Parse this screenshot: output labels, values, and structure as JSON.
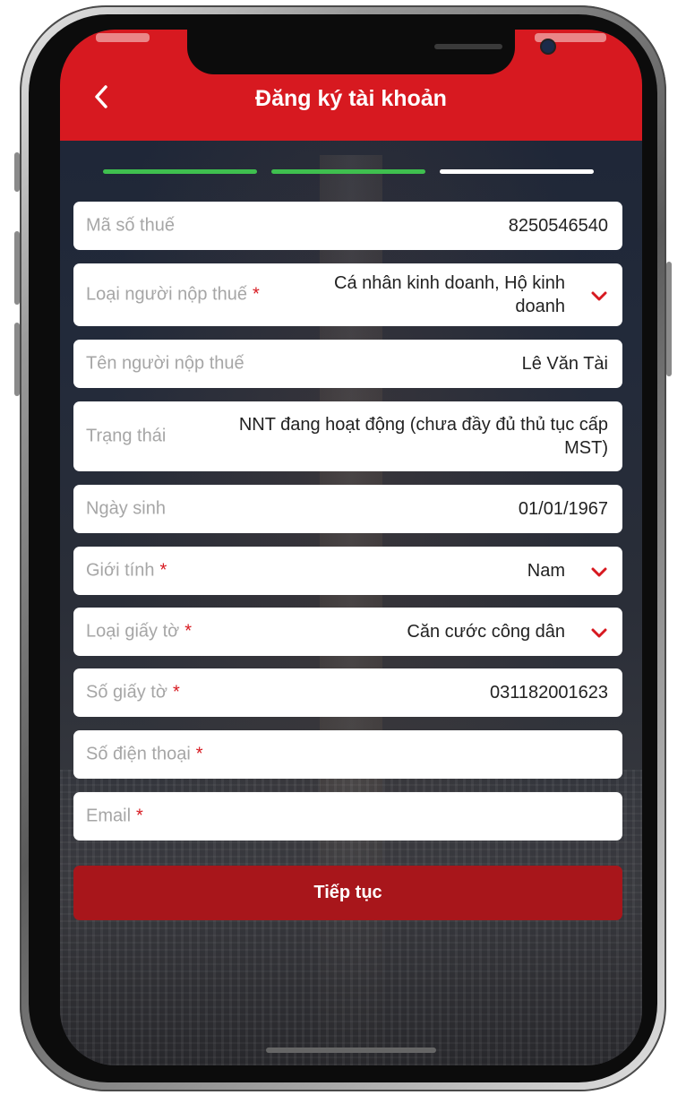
{
  "header": {
    "title": "Đăng ký tài khoản",
    "back_icon": "chevron-left-icon",
    "background_color": "#d71920"
  },
  "progress_steps": [
    {
      "state": "completed",
      "color": "#3fbf4f"
    },
    {
      "state": "completed",
      "color": "#3fbf4f"
    },
    {
      "state": "current",
      "color": "#ffffff"
    }
  ],
  "form": {
    "fields": [
      {
        "label": "Mã số thuế",
        "value": "8250546540",
        "required": false,
        "dropdown": false
      },
      {
        "label": "Loại người nộp thuế",
        "value": "Cá nhân kinh doanh, Hộ kinh doanh",
        "required": true,
        "dropdown": true
      },
      {
        "label": "Tên người nộp thuế",
        "value": "Lê Văn Tài",
        "required": false,
        "dropdown": false
      },
      {
        "label": "Trạng thái",
        "value": "NNT đang hoạt động (chưa đầy đủ thủ tục cấp MST)",
        "required": false,
        "dropdown": false
      },
      {
        "label": "Ngày sinh",
        "value": "01/01/1967",
        "required": false,
        "dropdown": false
      },
      {
        "label": "Giới tính",
        "value": "Nam",
        "required": true,
        "dropdown": true
      },
      {
        "label": "Loại giấy tờ",
        "value": "Căn cước công dân",
        "required": true,
        "dropdown": true
      },
      {
        "label": "Số giấy tờ",
        "value": "031182001623",
        "required": true,
        "dropdown": false
      },
      {
        "label": "Số điện thoại",
        "value": "",
        "required": true,
        "dropdown": false
      },
      {
        "label": "Email",
        "value": "",
        "required": true,
        "dropdown": false
      }
    ],
    "required_marker": "*",
    "required_color": "#d71920",
    "submit_label": "Tiếp tục",
    "submit_color": "#a8161b"
  }
}
